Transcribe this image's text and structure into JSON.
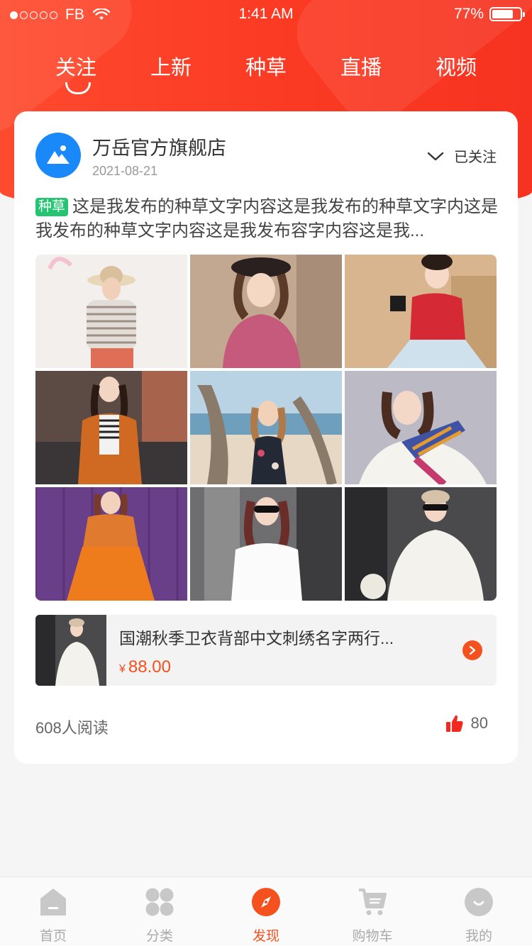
{
  "status_bar": {
    "carrier": "FB",
    "time": "1:41 AM",
    "battery": "77%",
    "battery_level": 0.77
  },
  "tabs": [
    {
      "label": "关注",
      "active": true
    },
    {
      "label": "上新",
      "active": false
    },
    {
      "label": "种草",
      "active": false
    },
    {
      "label": "直播",
      "active": false
    },
    {
      "label": "视频",
      "active": false
    }
  ],
  "post": {
    "shop_name": "万岳官方旗舰店",
    "date": "2021-08-21",
    "follow_label": "已关注",
    "tag": "种草",
    "text": "这是我发布的种草文字内容这是我发布的种草文字内这是我发布的种草文字内容这是我发布容字内容这是我...",
    "images": [
      "striped-tee-photo",
      "pink-sweater-photo",
      "red-top-photo",
      "orange-coat-photo",
      "beach-dress-photo",
      "scarf-photo",
      "orange-dress-photo",
      "white-lace-top-photo",
      "white-coat-photo"
    ],
    "product": {
      "name": "国潮秋季卫衣背部中文刺绣名字两行...",
      "currency": "¥",
      "price": "88.00"
    },
    "reads": "608人阅读",
    "likes": "80"
  },
  "bottom_nav": [
    {
      "label": "首页",
      "icon": "home-icon",
      "active": false
    },
    {
      "label": "分类",
      "icon": "category-icon",
      "active": false
    },
    {
      "label": "发现",
      "icon": "discover-compass-icon",
      "active": true
    },
    {
      "label": "购物车",
      "icon": "cart-icon",
      "active": false
    },
    {
      "label": "我的",
      "icon": "profile-icon",
      "active": false
    }
  ],
  "colors": {
    "brand_red": "#fb3a23",
    "price_orange": "#f4511e",
    "tag_green": "#25c472",
    "avatar_blue": "#1989fa"
  }
}
